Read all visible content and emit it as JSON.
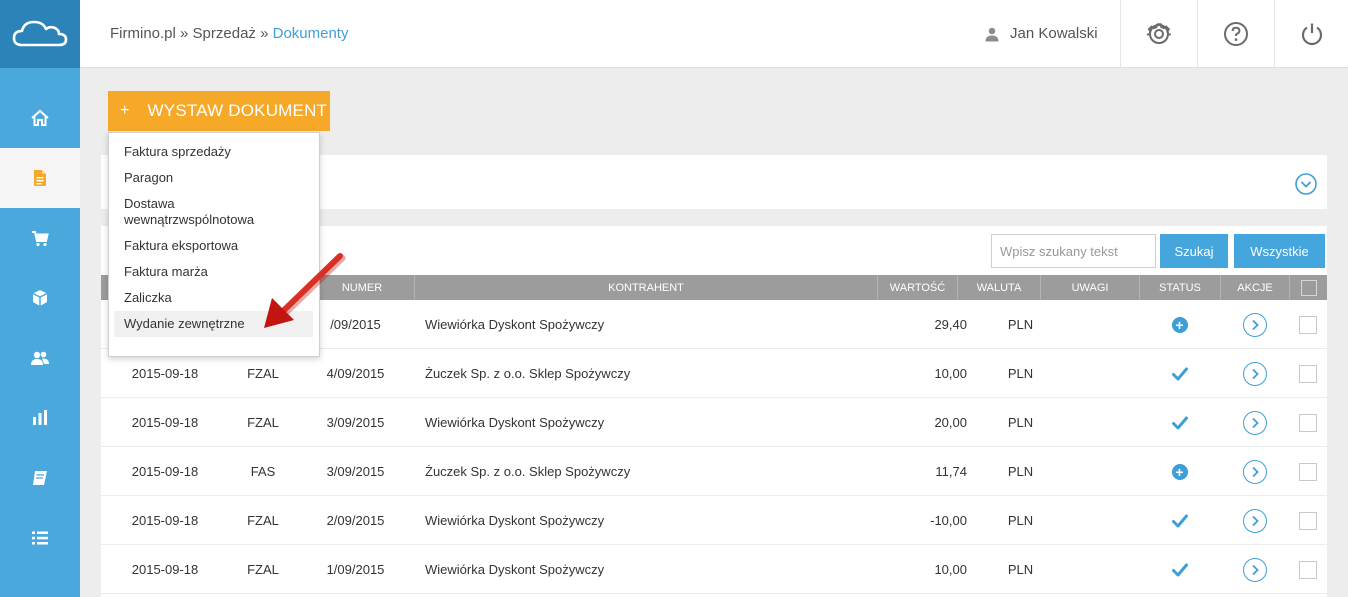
{
  "breadcrumb": {
    "root": "Firmino.pl",
    "section": "Sprzedaż",
    "current": "Dokumenty",
    "separator": "»"
  },
  "header": {
    "user_name": "Jan Kowalski"
  },
  "sidebar": {
    "items": [
      {
        "icon": "home-icon"
      },
      {
        "icon": "document-icon"
      },
      {
        "icon": "cart-icon"
      },
      {
        "icon": "box-icon"
      },
      {
        "icon": "users-icon"
      },
      {
        "icon": "bar-chart-icon"
      },
      {
        "icon": "book-icon"
      },
      {
        "icon": "list-icon"
      }
    ]
  },
  "issue_button": {
    "plus": "+",
    "label": "WYSTAW DOKUMENT"
  },
  "dropdown": {
    "items": [
      "Faktura sprzedaży",
      "Paragon",
      "Dostawa wewnątrzwspólnotowa",
      "Faktura eksportowa",
      "Faktura marża",
      "Zaliczka",
      "Wydanie zewnętrzne"
    ]
  },
  "search": {
    "placeholder": "Wpisz szukany tekst",
    "search_label": "Szukaj",
    "all_label": "Wszystkie"
  },
  "table": {
    "columns": {
      "numer": "NUMER",
      "kontrahent": "KONTRAHENT",
      "wartosc": "WARTOŚĆ",
      "waluta": "WALUTA",
      "uwagi": "UWAGI",
      "status": "STATUS",
      "akcje": "AKCJE"
    },
    "rows": [
      {
        "date": "",
        "type": "",
        "number": "/09/2015",
        "contractor": "Wiewiórka Dyskont Spożywczy",
        "value": "29,40",
        "currency": "PLN",
        "status": "plus"
      },
      {
        "date": "2015-09-18",
        "type": "FZAL",
        "number": "4/09/2015",
        "contractor": "Żuczek Sp. z o.o. Sklep Spożywczy",
        "value": "10,00",
        "currency": "PLN",
        "status": "check"
      },
      {
        "date": "2015-09-18",
        "type": "FZAL",
        "number": "3/09/2015",
        "contractor": "Wiewiórka Dyskont Spożywczy",
        "value": "20,00",
        "currency": "PLN",
        "status": "check"
      },
      {
        "date": "2015-09-18",
        "type": "FAS",
        "number": "3/09/2015",
        "contractor": "Żuczek Sp. z o.o. Sklep Spożywczy",
        "value": "11,74",
        "currency": "PLN",
        "status": "plus"
      },
      {
        "date": "2015-09-18",
        "type": "FZAL",
        "number": "2/09/2015",
        "contractor": "Wiewiórka Dyskont Spożywczy",
        "value": "-10,00",
        "currency": "PLN",
        "status": "check"
      },
      {
        "date": "2015-09-18",
        "type": "FZAL",
        "number": "1/09/2015",
        "contractor": "Wiewiórka Dyskont Spożywczy",
        "value": "10,00",
        "currency": "PLN",
        "status": "check"
      }
    ]
  }
}
